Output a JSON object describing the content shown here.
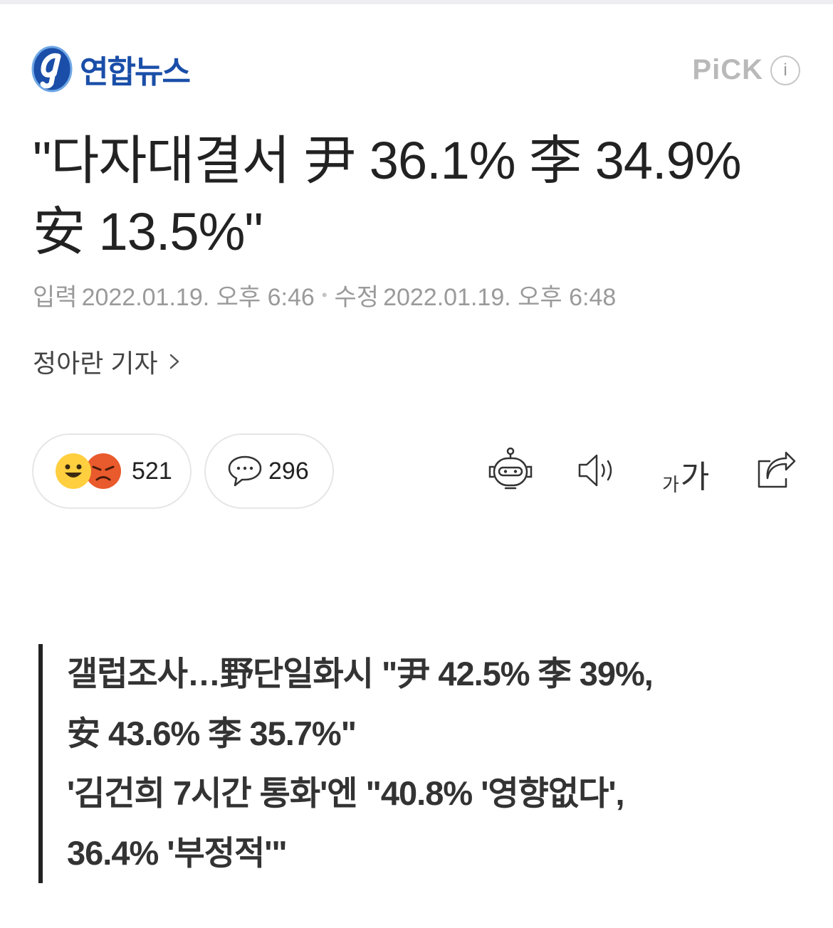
{
  "header": {
    "publisher": "연합뉴스",
    "pick_label": "PiCK",
    "info_icon": "i"
  },
  "article": {
    "title_line1": "\"다자대결서 尹 36.1% 李 34.9%",
    "title_line2": "安 13.5%\"",
    "input_label": "입력",
    "input_datetime": "2022.01.19. 오후 6:46",
    "separator": "•",
    "edit_label": "수정",
    "edit_datetime": "2022.01.19. 오후 6:48",
    "reporter": "정아란 기자"
  },
  "reactions": {
    "count": "521",
    "emojis": [
      "smile-emoji-icon",
      "angry-emoji-icon"
    ]
  },
  "comments": {
    "count": "296"
  },
  "tools": {
    "fontsize_small": "가",
    "fontsize_big": "가",
    "icons": [
      "robot-summary-icon",
      "speaker-icon",
      "font-size-icon",
      "share-icon"
    ]
  },
  "summary": {
    "lines": [
      "갤럽조사…野단일화시 \"尹 42.5% 李 39%,",
      "安 43.6% 李 35.7%\"",
      "'김건희 7시간 통화'엔 \"40.8% '영향없다',",
      "36.4% '부정적'\""
    ]
  },
  "colors": {
    "brand": "#1a4ea8",
    "muted": "#9a9a9a",
    "border": "#e6e6e6"
  }
}
